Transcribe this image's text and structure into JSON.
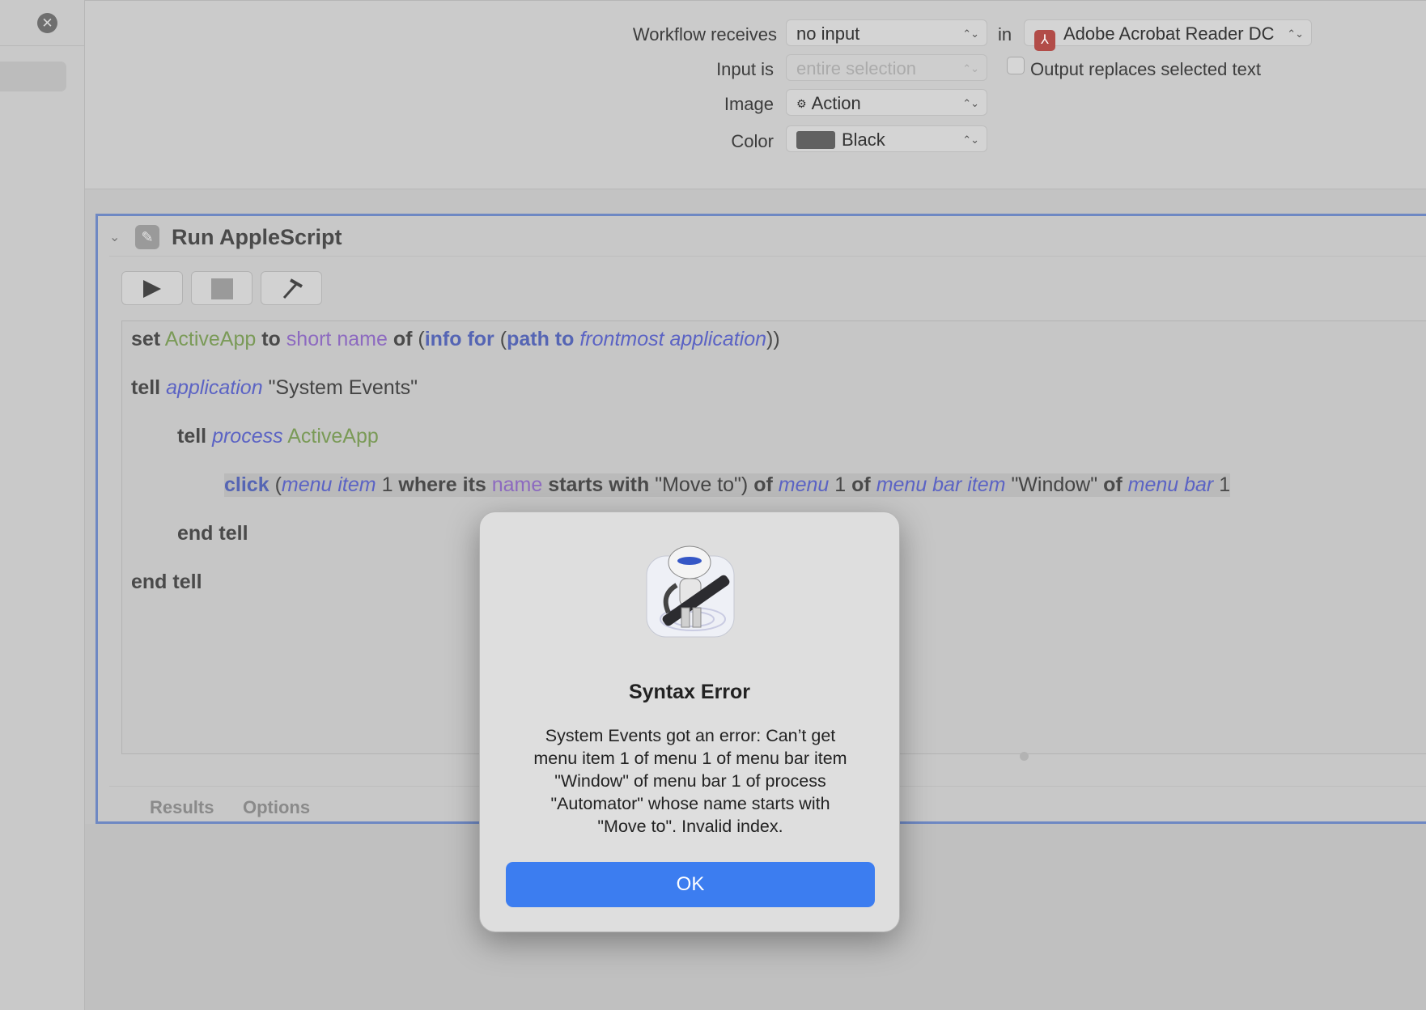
{
  "window": {
    "close_glyph": "✕"
  },
  "settings": {
    "workflow_receives_label": "Workflow receives",
    "workflow_receives_value": "no input",
    "in_label": "in",
    "app_value": "Adobe Acrobat Reader DC",
    "input_is_label": "Input is",
    "input_is_value": "entire selection",
    "output_replaces_label": "Output replaces selected text",
    "image_label": "Image",
    "image_value": "Action",
    "color_label": "Color",
    "color_value": "Black",
    "color_swatch": "#616161"
  },
  "action": {
    "title": "Run AppleScript",
    "tabs": [
      "Results",
      "Options"
    ]
  },
  "script": {
    "line1": {
      "kw_set": "set",
      "var": "ActiveApp",
      "kw_to": "to",
      "prop": "short name",
      "kw_of": "of",
      "paren1": "(",
      "cmd": "info for",
      "paren2": "(",
      "cmd2": "path to",
      "cls": "frontmost application",
      "close": "))"
    },
    "line2": {
      "kw": "tell",
      "cls": "application",
      "str": "\"System Events\""
    },
    "line3": {
      "kw": "tell",
      "cls": "process",
      "var": "ActiveApp"
    },
    "line4": {
      "cmd": "click",
      "p1": "(",
      "cls1": "menu item",
      "n1": "1",
      "kw1": "where its",
      "prop": "name",
      "kw2": "starts with",
      "str1": "\"Move to\")",
      "kw3": "of",
      "cls2": "menu",
      "n2": "1",
      "kw4": "of",
      "cls3": "menu bar item",
      "str2": "\"Window\"",
      "kw5": "of",
      "cls4": "menu bar",
      "n3": "1"
    },
    "line5": {
      "kw": "end tell"
    },
    "line6": {
      "kw": "end tell"
    }
  },
  "dialog": {
    "title": "Syntax Error",
    "message": "System Events got an error: Can’t get\nmenu item 1 of menu 1 of menu bar item\n\"Window\" of menu bar 1 of process\n\"Automator\" whose name starts with\n\"Move to\". Invalid index.",
    "ok_label": "OK"
  },
  "colors": {
    "accent": "#3c7df0",
    "selection_border": "#6e88c3"
  },
  "icons": {
    "close": "close-icon",
    "popup_arrows": "updown-chevron-icon",
    "pdf": "acrobat-icon",
    "action": "applescript-icon",
    "run": "play-icon",
    "stop": "stop-icon",
    "compile": "hammer-icon",
    "dialog": "automator-robot-icon"
  }
}
